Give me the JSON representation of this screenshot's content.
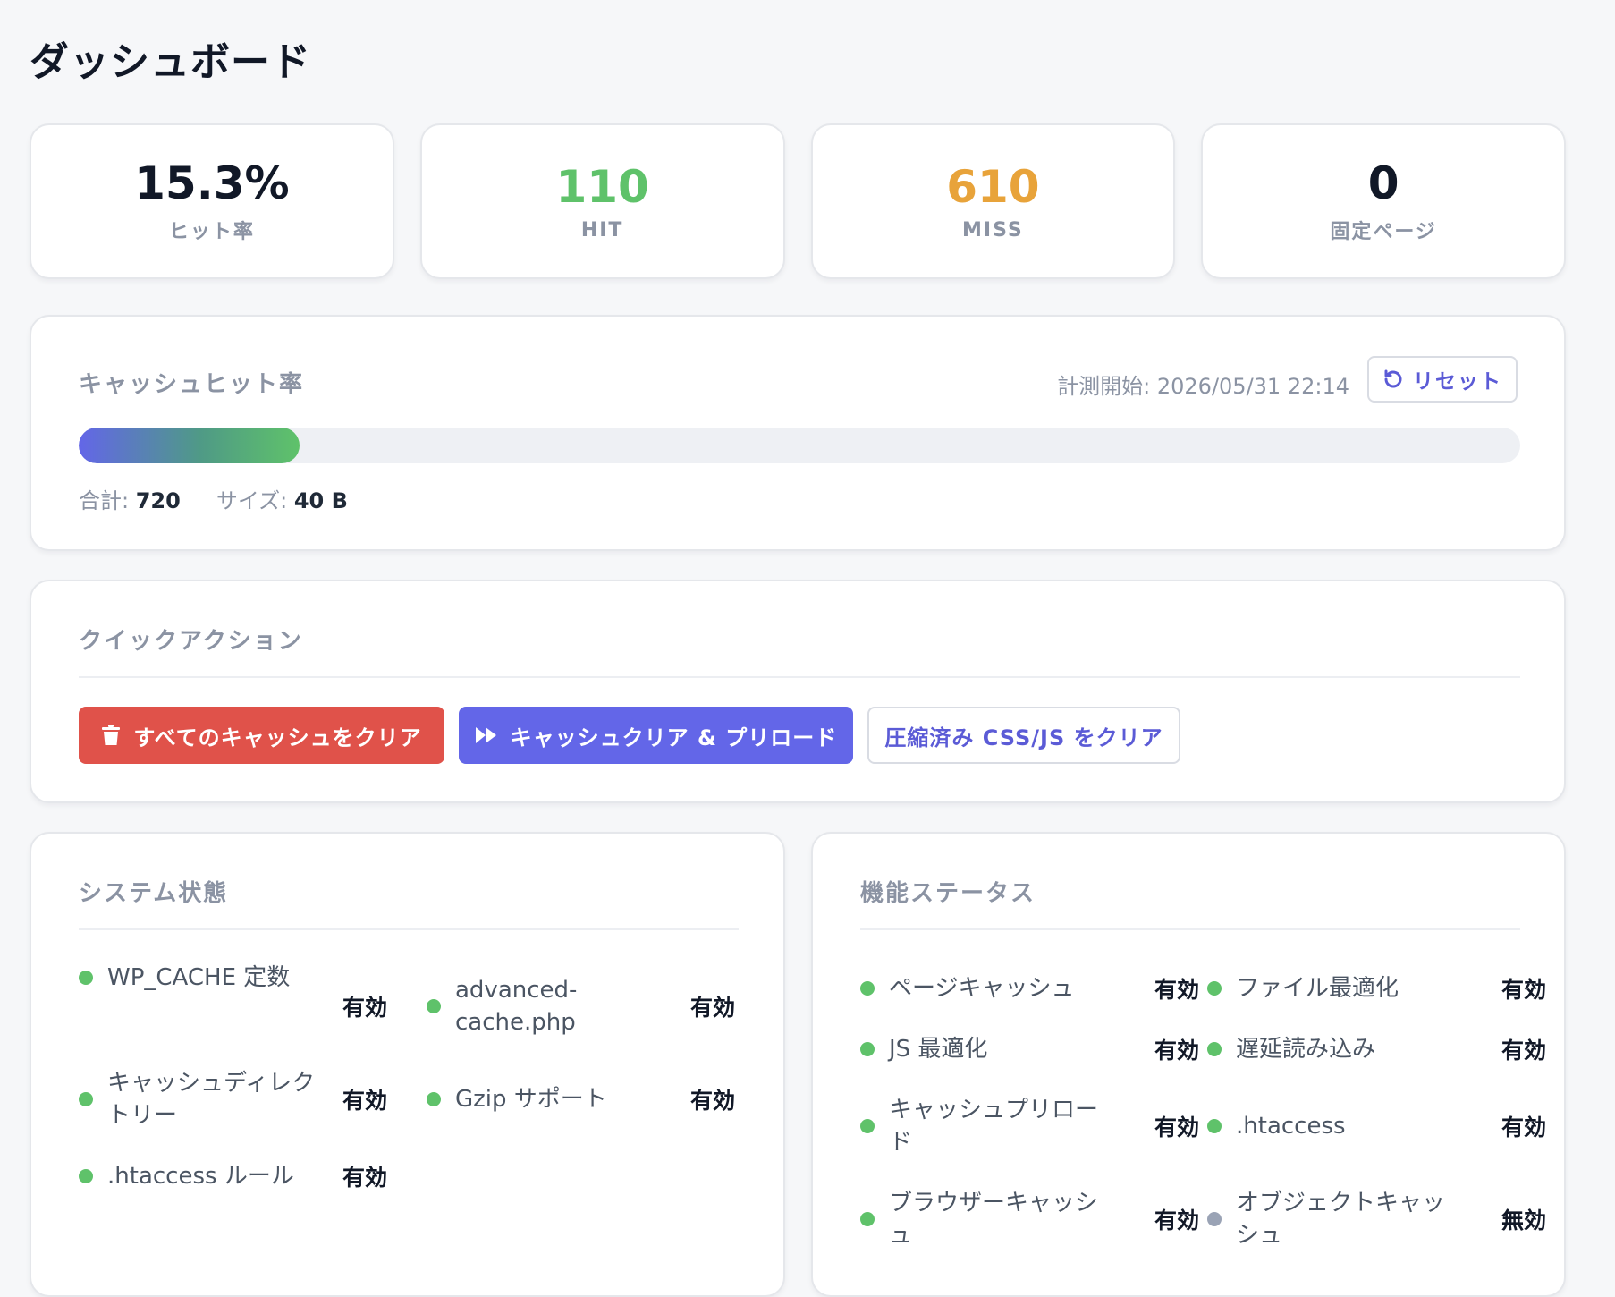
{
  "page_title": "ダッシュボード",
  "stats": [
    {
      "value": "15.3%",
      "label": "ヒット率"
    },
    {
      "value": "110",
      "label": "HIT"
    },
    {
      "value": "610",
      "label": "MISS"
    },
    {
      "value": "0",
      "label": "固定ページ"
    }
  ],
  "hit_rate_card": {
    "title": "キャッシュヒット率",
    "measure_start": "計測開始: 2026/05/31 22:14",
    "reset_label": "リセット",
    "progress_fraction": 0.153,
    "total_label": "合計:",
    "total_value": "720",
    "size_label": "サイズ:",
    "size_value": "40 B"
  },
  "quick_actions": {
    "title": "クイックアクション",
    "clear_all": "すべてのキャッシュをクリア",
    "clear_preload": "キャッシュクリア & プリロード",
    "clear_compressed": "圧縮済み CSS/JS をクリア"
  },
  "system_status": {
    "title": "システム状態",
    "items": [
      {
        "label": "WP_CACHE 定数",
        "value": "有効",
        "status": "ok"
      },
      {
        "label": "advanced-\ncache.php",
        "value": "有効",
        "status": "ok"
      },
      {
        "label": "キャッシュディレク\nトリー",
        "value": "有効",
        "status": "ok"
      },
      {
        "label": "Gzip サポート",
        "value": "有効",
        "status": "ok"
      },
      {
        "label": ".htaccess ルール",
        "value": "有効",
        "status": "ok"
      }
    ]
  },
  "feature_status": {
    "title": "機能ステータス",
    "items": [
      {
        "label": "ページキャッシュ",
        "value": "有効",
        "status": "ok"
      },
      {
        "label": "ファイル最適化",
        "value": "有効",
        "status": "ok"
      },
      {
        "label": "JS 最適化",
        "value": "有効",
        "status": "ok"
      },
      {
        "label": "遅延読み込み",
        "value": "有効",
        "status": "ok"
      },
      {
        "label": "キャッシュプリロー\nド",
        "value": "有効",
        "status": "ok"
      },
      {
        "label": ".htaccess",
        "value": "有効",
        "status": "ok"
      },
      {
        "label": "ブラウザーキャッシ\nュ",
        "value": "有効",
        "status": "ok"
      },
      {
        "label": "オブジェクトキャッ\nシュ",
        "value": "無効",
        "status": "off"
      }
    ]
  },
  "colors": {
    "hit": "#5fc26a",
    "miss": "#e8a33a",
    "accent": "#6366e8",
    "danger": "#e0524a",
    "status_ok": "#5fc26a",
    "status_off": "#9aa3b5"
  },
  "icons": {
    "reset": "rotate-ccw-icon",
    "clear_all": "trash-icon",
    "clear_preload": "fast-forward-icon"
  }
}
